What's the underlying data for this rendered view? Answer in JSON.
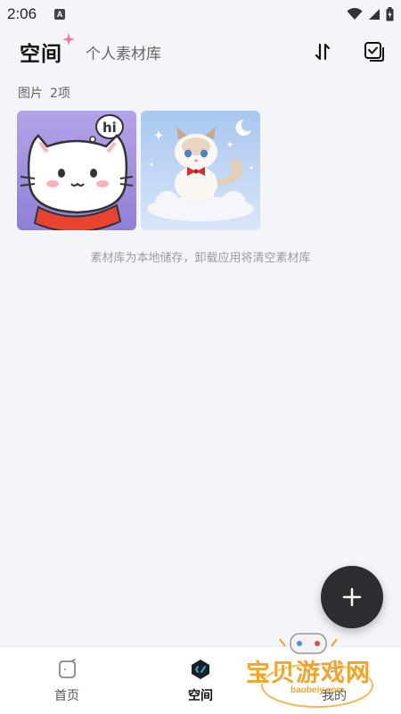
{
  "status_bar": {
    "time": "2:06",
    "notification_icon": "A"
  },
  "header": {
    "title": "空间",
    "subtitle": "个人素材库",
    "sort_icon": "sort-icon",
    "select_icon": "select-icon"
  },
  "section": {
    "label": "图片",
    "count": "2项"
  },
  "images": [
    {
      "name": "white-cat-hi-sticker"
    },
    {
      "name": "ragdoll-cat-on-cloud"
    }
  ],
  "notice": "素材库为本地储存，卸载应用将清空素材库",
  "fab": {
    "icon": "plus-icon"
  },
  "bottom_nav": {
    "items": [
      {
        "label": "首页",
        "icon": "home-icon",
        "active": false
      },
      {
        "label": "空间",
        "icon": "space-icon",
        "active": true
      },
      {
        "label": "我的",
        "icon": "profile-icon",
        "active": false
      }
    ]
  },
  "watermark": {
    "text": "宝贝游戏网",
    "url": "baobeiy.com"
  },
  "colors": {
    "background": "#f4f5f9",
    "fab": "#2b2d31",
    "accent_pink": "#ff6aa0",
    "active_icon": "#1fb6c9",
    "watermark": "#f0a52a"
  }
}
